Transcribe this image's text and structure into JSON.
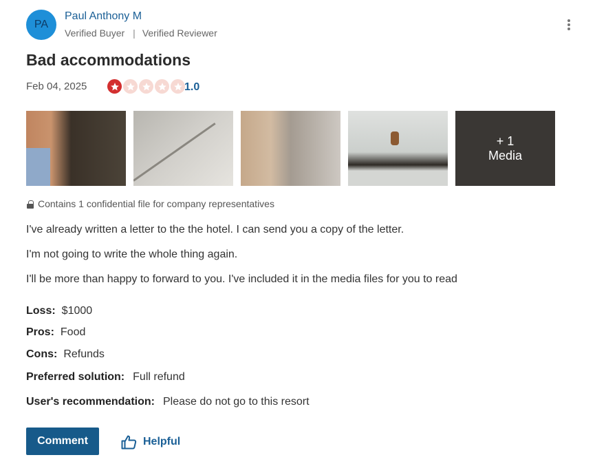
{
  "author": {
    "initials": "PA",
    "name": "Paul Anthony M",
    "badges": [
      "Verified Buyer",
      "Verified Reviewer"
    ]
  },
  "review": {
    "title": "Bad accommodations",
    "date": "Feb 04, 2025",
    "rating": 1.0,
    "rating_text": "1.0",
    "rating_max": 5,
    "media": {
      "more_count": "+ 1",
      "more_label": "Media"
    },
    "confidential_note": "Contains 1 confidential file for company representatives",
    "paragraphs": [
      "I've already written a letter to the the hotel. I can send you a copy of the letter.",
      "I'm not going to write the whole thing again.",
      "I'll be more than happy to forward to you. I've included it in the media files for you to read"
    ],
    "fields": [
      {
        "label": "Loss:",
        "value": "$1000"
      },
      {
        "label": "Pros:",
        "value": "Food"
      },
      {
        "label": "Cons:",
        "value": "Refunds"
      },
      {
        "label": "Preferred solution:",
        "value": "Full refund"
      },
      {
        "label": "User's recommendation:",
        "value": "Please do not go to this resort"
      }
    ]
  },
  "actions": {
    "comment_label": "Comment",
    "helpful_label": "Helpful"
  },
  "colors": {
    "accent": "#1a5f96",
    "button_bg": "#175a8a",
    "star_filled": "#d32f2f",
    "star_empty": "#f7d9d3"
  }
}
